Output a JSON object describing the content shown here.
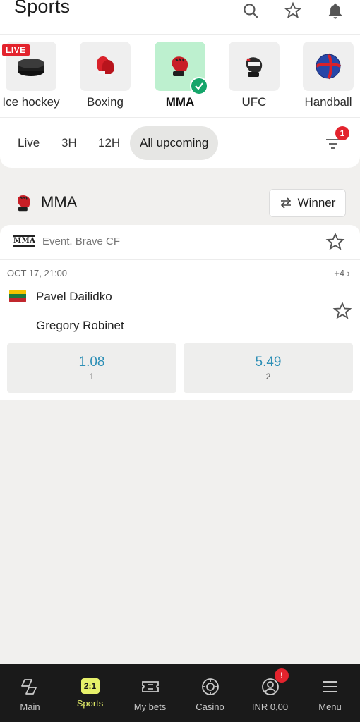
{
  "header": {
    "title": "Sports"
  },
  "sports": [
    {
      "label": "Ice hockey",
      "live": "LIVE"
    },
    {
      "label": "Boxing"
    },
    {
      "label": "MMA",
      "selected": true
    },
    {
      "label": "UFC"
    },
    {
      "label": "Handball"
    }
  ],
  "filters": {
    "chips": [
      "Live",
      "3H",
      "12H",
      "All upcoming"
    ],
    "active": "All upcoming",
    "badge": "1"
  },
  "section": {
    "title": "MMA",
    "market_button": "Winner"
  },
  "event": {
    "league_logo": "MMA",
    "league_name": "Event. Brave CF",
    "time": "OCT 17, 21:00",
    "more_markets": "+4 ›",
    "team1": "Pavel Dailidko",
    "team2": "Gregory Robinet",
    "odds": [
      {
        "value": "1.08",
        "label": "1"
      },
      {
        "value": "5.49",
        "label": "2"
      }
    ]
  },
  "bottom_nav": {
    "items": [
      "Main",
      "Sports",
      "My bets",
      "Casino",
      "INR 0,00",
      "Menu"
    ],
    "sports_icon_text": "2:1",
    "account_badge": "!"
  },
  "colors": {
    "accent": "#e6f06a",
    "odds": "#2d8fb6",
    "live": "#e3232d",
    "selected": "#bdf0cf"
  }
}
